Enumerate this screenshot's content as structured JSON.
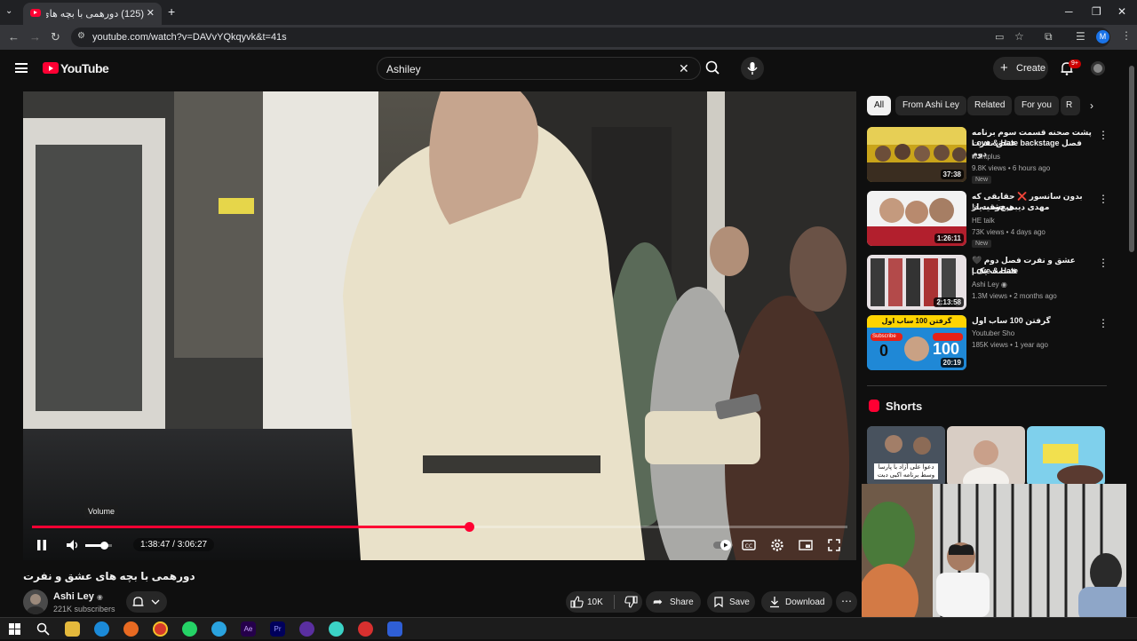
{
  "browser": {
    "tab_title": "(125) دورهمی با بچه های عشق",
    "url": "youtube.com/watch?v=DAVvYQkqyvk&t=41s",
    "profile_initial": "M"
  },
  "youtube": {
    "logo_text": "YouTube",
    "search_value": "Ashiley",
    "create_label": "Create",
    "notification_count": "9+"
  },
  "player": {
    "volume_tooltip": "Volume",
    "time_current": "1:38:47",
    "time_sep": " / ",
    "time_total": "3:06:27",
    "progress_fraction": 0.536,
    "volume_fraction": 0.7,
    "video_title": "دورهمی با بچه های عشق و نفرت"
  },
  "channel": {
    "name": "Ashi Ley",
    "verified": "◉",
    "subscribers": "221K subscribers"
  },
  "actions": {
    "likes": "10K",
    "share": "Share",
    "save": "Save",
    "download": "Download"
  },
  "chips": [
    "All",
    "From Ashi Ley",
    "Related",
    "For you",
    "R"
  ],
  "recommendations": [
    {
      "title_line1": "پشت صحنه قسمت سوم برنامه عشق نفرت",
      "title_line2": "Love & Hate  backstage فصل دوم",
      "channel": "tv2htplus",
      "meta": "9.8K views • 6 hours ago",
      "badge": "New",
      "duration": "37:38",
      "thumb_color": "#c9a41a"
    },
    {
      "title_line1": "بدون سانسور ❌ حقایقی که هیچ‌وقت از",
      "title_line2": "مهدی دیبی نشنیدید!",
      "channel": "HE talk",
      "meta": "73K views • 4 days ago",
      "badge": "New",
      "duration": "1:26:11",
      "thumb_color": "#b21f2d"
    },
    {
      "title_line1": "عشق و نفرت فصل دوم 🖤 قسمت یک |",
      "title_line2": "Love & Hate",
      "channel": "Ashi Ley",
      "meta": "1.3M views • 2 months ago",
      "badge": "",
      "duration": "2:13:58",
      "thumb_color": "#e8e1e4"
    },
    {
      "title_line1": "گرفتن 100 ساب اول",
      "title_line2": "",
      "channel": "Youtuber Sho",
      "meta": "185K views • 1 year ago",
      "badge": "",
      "duration": "20:19",
      "thumb_color": "#1f88d6",
      "thumb_text_left": "Subscribe",
      "thumb_num_left": "0",
      "thumb_num_right": "100",
      "thumb_banner": "گرفتن 100 ساب اول"
    }
  ],
  "shorts": {
    "label": "Shorts",
    "first_caption": "دعوا علی آزاد با پارسا وسط برنامه اکبی دبت"
  },
  "colors": {
    "accent": "#ff0033",
    "background": "#0f0f0f",
    "chip_bg": "#272727"
  }
}
